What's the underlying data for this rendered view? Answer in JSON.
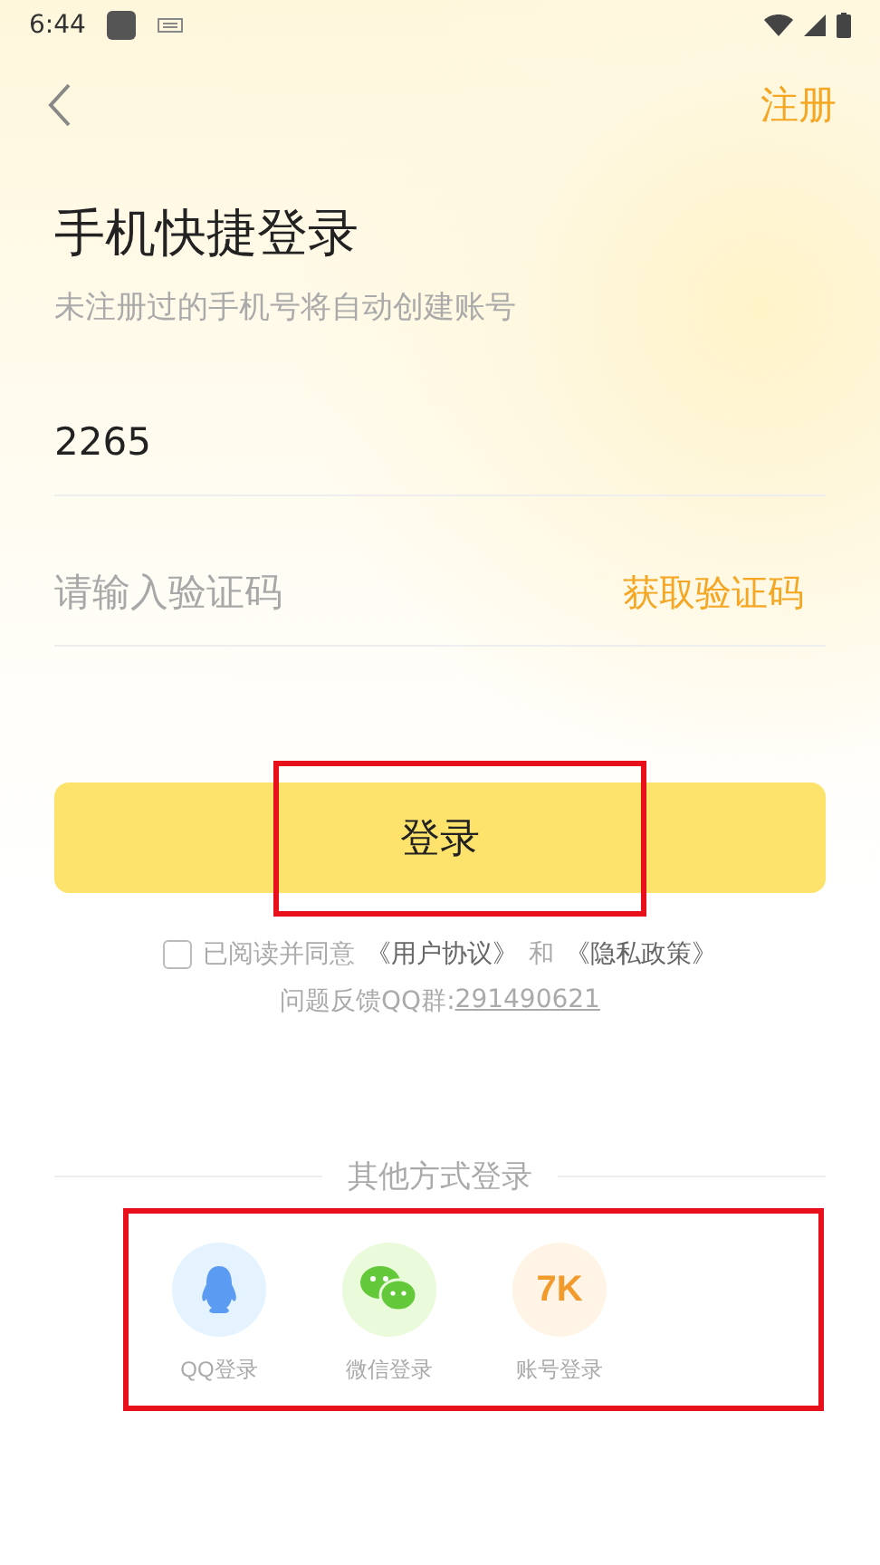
{
  "status_bar": {
    "time": "6:44"
  },
  "nav": {
    "register": "注册"
  },
  "title": "手机快捷登录",
  "subtitle": "未注册过的手机号将自动创建账号",
  "phone_field": {
    "value": "2265"
  },
  "code_field": {
    "placeholder": "请输入验证码",
    "get_code": "获取验证码"
  },
  "login_button": "登录",
  "agreement": {
    "checked": false,
    "prefix": "已阅读并同意",
    "terms_link": "《用户协议》",
    "connector": "和",
    "privacy_link": "《隐私政策》"
  },
  "feedback": {
    "label": "问题反馈QQ群:",
    "group_link": "291490621"
  },
  "other_login": {
    "heading": "其他方式登录",
    "options": [
      {
        "kind": "qq",
        "label": "QQ登录"
      },
      {
        "kind": "wechat",
        "label": "微信登录"
      },
      {
        "kind": "account",
        "icon_text": "7K",
        "label": "账号登录"
      }
    ]
  }
}
